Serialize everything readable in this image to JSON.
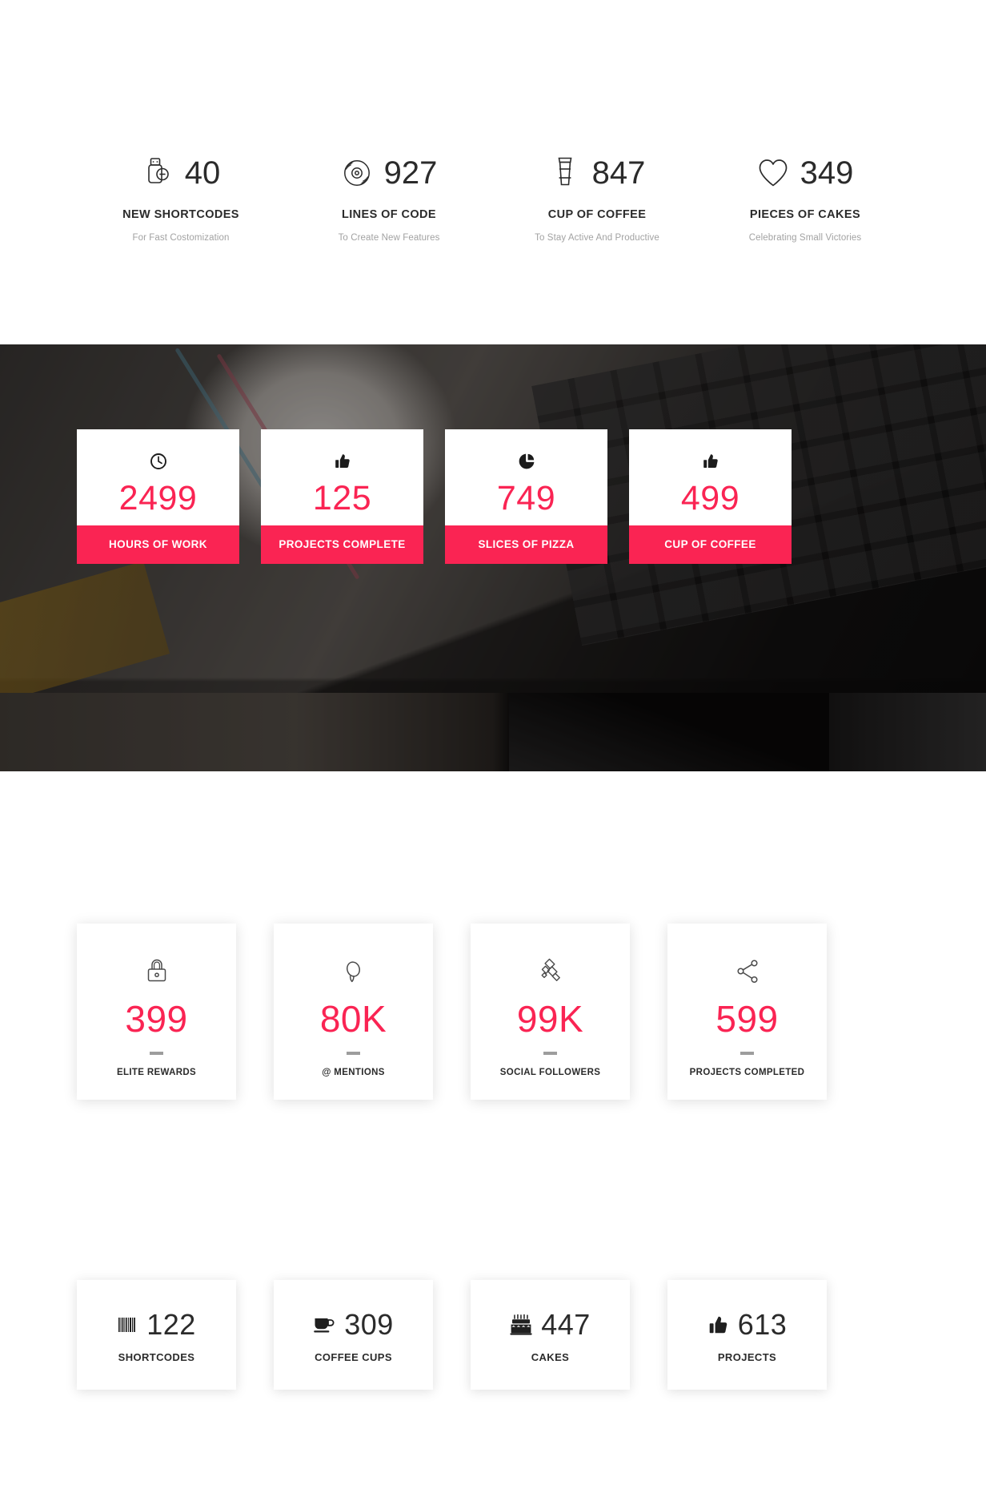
{
  "accent": {
    "red": "#FA2453",
    "dark_text": "#2b2b2b",
    "muted_text": "#a2a2a2",
    "divider": "#9d9d9d"
  },
  "section_plain": {
    "name": "plain-inline-counters",
    "items": [
      {
        "icon": "usb-flash-drive-icon",
        "number": "40",
        "title": "NEW SHORTCODES",
        "subtitle": "For Fast Costomization"
      },
      {
        "icon": "vinyl-record-icon",
        "number": "927",
        "title": "LINES OF CODE",
        "subtitle": "To Create New Features"
      },
      {
        "icon": "coffee-togo-cup-icon",
        "number": "847",
        "title": "CUP OF COFFEE",
        "subtitle": "To Stay Active And Productive"
      },
      {
        "icon": "heart-outline-icon",
        "number": "349",
        "title": "PIECES OF CAKES",
        "subtitle": "Celebrating Small Victories"
      }
    ]
  },
  "section_photo": {
    "name": "photo-background-counters",
    "cards": [
      {
        "icon": "clock-icon",
        "number": "2499",
        "label": "HOURS OF WORK"
      },
      {
        "icon": "thumbs-up-icon",
        "number": "125",
        "label": "PROJECTS COMPLETE"
      },
      {
        "icon": "pie-chart-icon",
        "number": "749",
        "label": "SLICES OF PIZZA"
      },
      {
        "icon": "thumbs-up-icon",
        "number": "499",
        "label": "CUP OF COFFEE"
      }
    ]
  },
  "section_tall": {
    "name": "tall-shadow-counter-cards",
    "cards": [
      {
        "icon": "padlock-icon",
        "number": "399",
        "label": "ELITE REWARDS"
      },
      {
        "icon": "magnifier-icon",
        "number": "80K",
        "label": "@ MENTIONS"
      },
      {
        "icon": "satellite-icon",
        "number": "99K",
        "label": "SOCIAL FOLLOWERS"
      },
      {
        "icon": "share-network-icon",
        "number": "599",
        "label": "PROJECTS COMPLETED"
      }
    ]
  },
  "section_wide": {
    "name": "wide-shadow-counter-cards",
    "cards": [
      {
        "icon": "barcode-icon",
        "number": "122",
        "label": "SHORTCODES"
      },
      {
        "icon": "coffee-mug-icon",
        "number": "309",
        "label": "COFFEE CUPS"
      },
      {
        "icon": "birthday-cake-icon",
        "number": "447",
        "label": "CAKES"
      },
      {
        "icon": "thumbs-up-icon",
        "number": "613",
        "label": "PROJECTS"
      }
    ]
  }
}
